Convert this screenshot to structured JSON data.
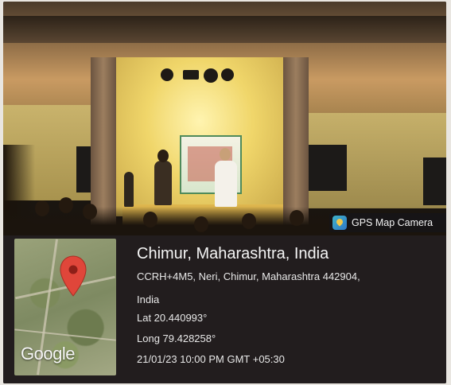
{
  "app_badge": {
    "name": "GPS Map Camera",
    "icon": "gps-map-camera-app-icon"
  },
  "location": {
    "title": "Chimur, Maharashtra, India",
    "address_line": "CCRH+4M5, Neri, Chimur, Maharashtra 442904,",
    "address_line2": "India",
    "lat": "Lat 20.440993°",
    "long": "Long 79.428258°",
    "datetime": "21/01/23 10:00 PM GMT +05:30"
  },
  "map": {
    "provider_logo": "Google",
    "pin_icon": "map-pin-icon",
    "pin_color": "#e0463a"
  },
  "colors": {
    "panel_bg": "#231e20",
    "stage_light": "#f0d66a"
  }
}
